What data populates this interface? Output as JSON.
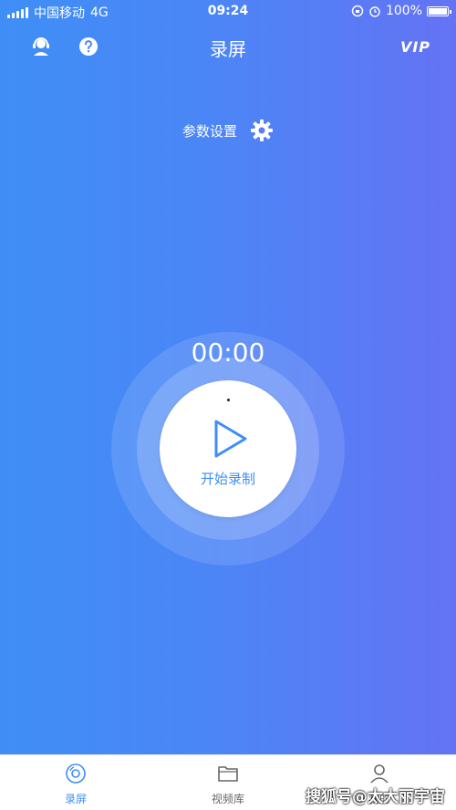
{
  "status_bar": {
    "carrier": "中国移动",
    "network": "4G",
    "time": "09:24",
    "battery": "100%",
    "battery_level": 1.0
  },
  "nav": {
    "title": "录屏",
    "vip": "VIP"
  },
  "settings": {
    "label": "参数设置"
  },
  "recorder": {
    "timer": "00:00",
    "button_label": "开始录制"
  },
  "tabs": [
    {
      "label": "录屏",
      "icon": "record-disc-icon"
    },
    {
      "label": "视频库",
      "icon": "folder-icon"
    },
    {
      "label": "我的",
      "icon": "user-icon"
    }
  ],
  "watermark": "搜狐号@太大丽宇宙",
  "colors": {
    "accent": "#3f8ef6",
    "gradient_start": "#3f8ef6",
    "gradient_end": "#6473f4"
  }
}
